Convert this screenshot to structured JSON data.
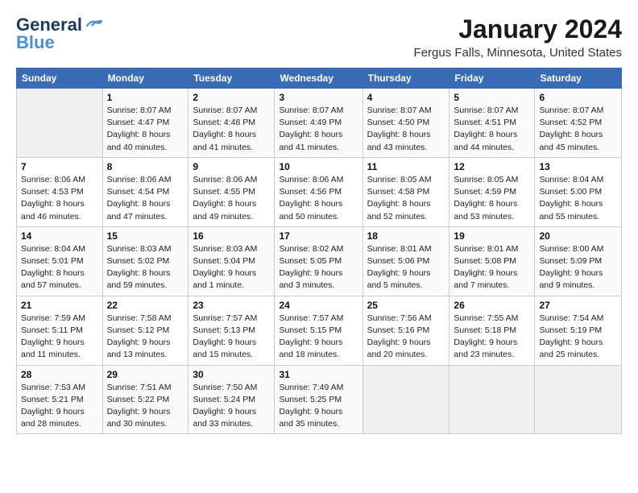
{
  "logo": {
    "line1": "General",
    "line2": "Blue"
  },
  "title": "January 2024",
  "subtitle": "Fergus Falls, Minnesota, United States",
  "weekdays": [
    "Sunday",
    "Monday",
    "Tuesday",
    "Wednesday",
    "Thursday",
    "Friday",
    "Saturday"
  ],
  "weeks": [
    [
      {
        "day": "",
        "empty": true
      },
      {
        "day": "1",
        "sunrise": "Sunrise: 8:07 AM",
        "sunset": "Sunset: 4:47 PM",
        "daylight": "Daylight: 8 hours and 40 minutes."
      },
      {
        "day": "2",
        "sunrise": "Sunrise: 8:07 AM",
        "sunset": "Sunset: 4:48 PM",
        "daylight": "Daylight: 8 hours and 41 minutes."
      },
      {
        "day": "3",
        "sunrise": "Sunrise: 8:07 AM",
        "sunset": "Sunset: 4:49 PM",
        "daylight": "Daylight: 8 hours and 41 minutes."
      },
      {
        "day": "4",
        "sunrise": "Sunrise: 8:07 AM",
        "sunset": "Sunset: 4:50 PM",
        "daylight": "Daylight: 8 hours and 43 minutes."
      },
      {
        "day": "5",
        "sunrise": "Sunrise: 8:07 AM",
        "sunset": "Sunset: 4:51 PM",
        "daylight": "Daylight: 8 hours and 44 minutes."
      },
      {
        "day": "6",
        "sunrise": "Sunrise: 8:07 AM",
        "sunset": "Sunset: 4:52 PM",
        "daylight": "Daylight: 8 hours and 45 minutes."
      }
    ],
    [
      {
        "day": "7",
        "sunrise": "Sunrise: 8:06 AM",
        "sunset": "Sunset: 4:53 PM",
        "daylight": "Daylight: 8 hours and 46 minutes."
      },
      {
        "day": "8",
        "sunrise": "Sunrise: 8:06 AM",
        "sunset": "Sunset: 4:54 PM",
        "daylight": "Daylight: 8 hours and 47 minutes."
      },
      {
        "day": "9",
        "sunrise": "Sunrise: 8:06 AM",
        "sunset": "Sunset: 4:55 PM",
        "daylight": "Daylight: 8 hours and 49 minutes."
      },
      {
        "day": "10",
        "sunrise": "Sunrise: 8:06 AM",
        "sunset": "Sunset: 4:56 PM",
        "daylight": "Daylight: 8 hours and 50 minutes."
      },
      {
        "day": "11",
        "sunrise": "Sunrise: 8:05 AM",
        "sunset": "Sunset: 4:58 PM",
        "daylight": "Daylight: 8 hours and 52 minutes."
      },
      {
        "day": "12",
        "sunrise": "Sunrise: 8:05 AM",
        "sunset": "Sunset: 4:59 PM",
        "daylight": "Daylight: 8 hours and 53 minutes."
      },
      {
        "day": "13",
        "sunrise": "Sunrise: 8:04 AM",
        "sunset": "Sunset: 5:00 PM",
        "daylight": "Daylight: 8 hours and 55 minutes."
      }
    ],
    [
      {
        "day": "14",
        "sunrise": "Sunrise: 8:04 AM",
        "sunset": "Sunset: 5:01 PM",
        "daylight": "Daylight: 8 hours and 57 minutes."
      },
      {
        "day": "15",
        "sunrise": "Sunrise: 8:03 AM",
        "sunset": "Sunset: 5:02 PM",
        "daylight": "Daylight: 8 hours and 59 minutes."
      },
      {
        "day": "16",
        "sunrise": "Sunrise: 8:03 AM",
        "sunset": "Sunset: 5:04 PM",
        "daylight": "Daylight: 9 hours and 1 minute."
      },
      {
        "day": "17",
        "sunrise": "Sunrise: 8:02 AM",
        "sunset": "Sunset: 5:05 PM",
        "daylight": "Daylight: 9 hours and 3 minutes."
      },
      {
        "day": "18",
        "sunrise": "Sunrise: 8:01 AM",
        "sunset": "Sunset: 5:06 PM",
        "daylight": "Daylight: 9 hours and 5 minutes."
      },
      {
        "day": "19",
        "sunrise": "Sunrise: 8:01 AM",
        "sunset": "Sunset: 5:08 PM",
        "daylight": "Daylight: 9 hours and 7 minutes."
      },
      {
        "day": "20",
        "sunrise": "Sunrise: 8:00 AM",
        "sunset": "Sunset: 5:09 PM",
        "daylight": "Daylight: 9 hours and 9 minutes."
      }
    ],
    [
      {
        "day": "21",
        "sunrise": "Sunrise: 7:59 AM",
        "sunset": "Sunset: 5:11 PM",
        "daylight": "Daylight: 9 hours and 11 minutes."
      },
      {
        "day": "22",
        "sunrise": "Sunrise: 7:58 AM",
        "sunset": "Sunset: 5:12 PM",
        "daylight": "Daylight: 9 hours and 13 minutes."
      },
      {
        "day": "23",
        "sunrise": "Sunrise: 7:57 AM",
        "sunset": "Sunset: 5:13 PM",
        "daylight": "Daylight: 9 hours and 15 minutes."
      },
      {
        "day": "24",
        "sunrise": "Sunrise: 7:57 AM",
        "sunset": "Sunset: 5:15 PM",
        "daylight": "Daylight: 9 hours and 18 minutes."
      },
      {
        "day": "25",
        "sunrise": "Sunrise: 7:56 AM",
        "sunset": "Sunset: 5:16 PM",
        "daylight": "Daylight: 9 hours and 20 minutes."
      },
      {
        "day": "26",
        "sunrise": "Sunrise: 7:55 AM",
        "sunset": "Sunset: 5:18 PM",
        "daylight": "Daylight: 9 hours and 23 minutes."
      },
      {
        "day": "27",
        "sunrise": "Sunrise: 7:54 AM",
        "sunset": "Sunset: 5:19 PM",
        "daylight": "Daylight: 9 hours and 25 minutes."
      }
    ],
    [
      {
        "day": "28",
        "sunrise": "Sunrise: 7:53 AM",
        "sunset": "Sunset: 5:21 PM",
        "daylight": "Daylight: 9 hours and 28 minutes."
      },
      {
        "day": "29",
        "sunrise": "Sunrise: 7:51 AM",
        "sunset": "Sunset: 5:22 PM",
        "daylight": "Daylight: 9 hours and 30 minutes."
      },
      {
        "day": "30",
        "sunrise": "Sunrise: 7:50 AM",
        "sunset": "Sunset: 5:24 PM",
        "daylight": "Daylight: 9 hours and 33 minutes."
      },
      {
        "day": "31",
        "sunrise": "Sunrise: 7:49 AM",
        "sunset": "Sunset: 5:25 PM",
        "daylight": "Daylight: 9 hours and 35 minutes."
      },
      {
        "day": "",
        "empty": true
      },
      {
        "day": "",
        "empty": true
      },
      {
        "day": "",
        "empty": true
      }
    ]
  ]
}
